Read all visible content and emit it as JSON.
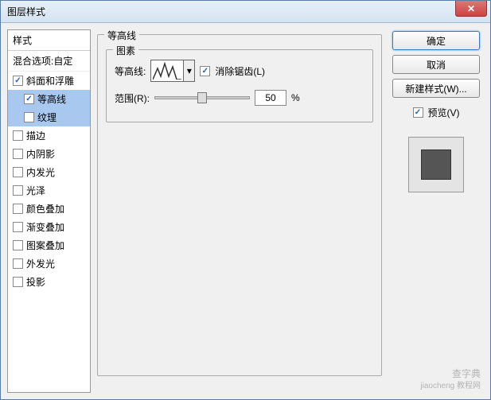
{
  "window": {
    "title": "图层样式"
  },
  "left": {
    "styles_header": "样式",
    "blend_options": "混合选项:自定",
    "items": [
      {
        "label": "斜面和浮雕",
        "checked": true,
        "selected": false,
        "sub": false
      },
      {
        "label": "等高线",
        "checked": true,
        "selected": true,
        "sub": true
      },
      {
        "label": "纹理",
        "checked": false,
        "selected": true,
        "sub": true
      },
      {
        "label": "描边",
        "checked": false,
        "selected": false,
        "sub": false
      },
      {
        "label": "内阴影",
        "checked": false,
        "selected": false,
        "sub": false
      },
      {
        "label": "内发光",
        "checked": false,
        "selected": false,
        "sub": false
      },
      {
        "label": "光泽",
        "checked": false,
        "selected": false,
        "sub": false
      },
      {
        "label": "颜色叠加",
        "checked": false,
        "selected": false,
        "sub": false
      },
      {
        "label": "渐变叠加",
        "checked": false,
        "selected": false,
        "sub": false
      },
      {
        "label": "图案叠加",
        "checked": false,
        "selected": false,
        "sub": false
      },
      {
        "label": "外发光",
        "checked": false,
        "selected": false,
        "sub": false
      },
      {
        "label": "投影",
        "checked": false,
        "selected": false,
        "sub": false
      }
    ]
  },
  "middle": {
    "section_title": "等高线",
    "group_title": "图素",
    "contour_label": "等高线:",
    "antialias_label": "消除锯齿(L)",
    "antialias_checked": true,
    "range_label": "范围(R):",
    "range_value": "50",
    "range_unit": "%"
  },
  "right": {
    "ok": "确定",
    "cancel": "取消",
    "new_style": "新建样式(W)...",
    "preview_label": "预览(V)",
    "preview_checked": true
  },
  "watermark": {
    "main": "查字典",
    "sub": "jiaocheng 教程网"
  }
}
